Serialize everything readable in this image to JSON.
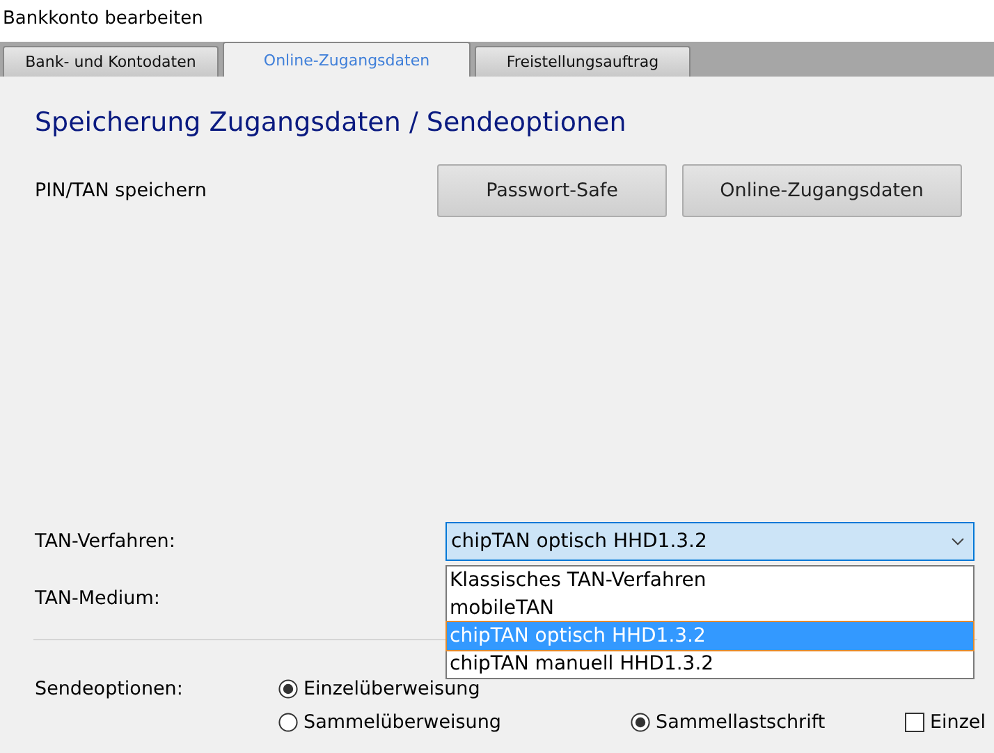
{
  "window": {
    "title": "Bankkonto bearbeiten"
  },
  "tabs": [
    {
      "label": "Bank- und Kontodaten",
      "selected": false
    },
    {
      "label": "Online-Zugangsdaten",
      "selected": true
    },
    {
      "label": "Freistellungsauftrag",
      "selected": false
    }
  ],
  "heading": "Speicherung Zugangsdaten / Sendeoptionen",
  "pin_row": {
    "label": "PIN/TAN speichern",
    "buttons": [
      "Passwort-Safe",
      "Online-Zugangsdaten"
    ]
  },
  "tan_method": {
    "label": "TAN-Verfahren:",
    "value": "chipTAN optisch HHD1.3.2",
    "expanded": true,
    "options": [
      {
        "label": "Klassisches TAN-Verfahren",
        "selected": false
      },
      {
        "label": "mobileTAN",
        "selected": false
      },
      {
        "label": "chipTAN optisch HHD1.3.2",
        "selected": true
      },
      {
        "label": "chipTAN manuell HHD1.3.2",
        "selected": false
      }
    ]
  },
  "tan_medium": {
    "label": "TAN-Medium:"
  },
  "send_options": {
    "label": "Sendeoptionen:",
    "items": [
      {
        "kind": "radio",
        "label": "Einzelüberweisung",
        "checked": true
      },
      {
        "kind": "radio",
        "label": "Sammelüberweisung",
        "checked": false
      },
      {
        "kind": "radio",
        "label": "Sammellastschrift",
        "checked": true
      },
      {
        "kind": "checkbox",
        "label": "Einzel",
        "checked": false
      }
    ]
  }
}
